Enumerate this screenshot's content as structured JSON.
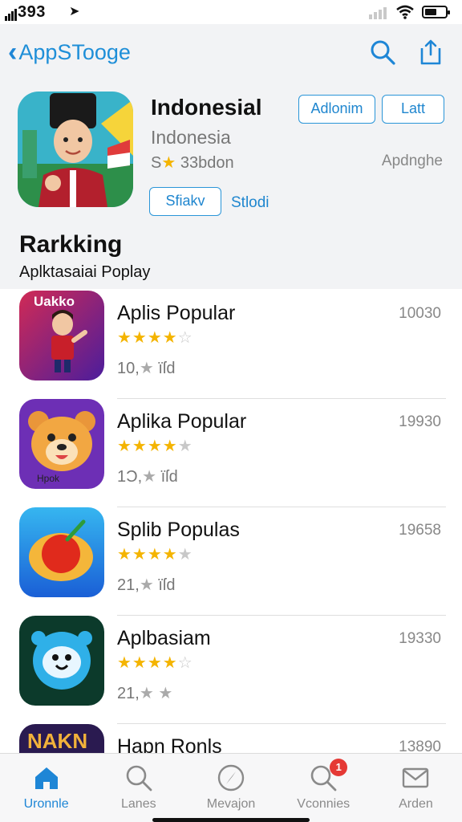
{
  "status": {
    "time": "393"
  },
  "header": {
    "back_label": "AppSTooge"
  },
  "featured": {
    "title": "Indonesial",
    "subtitle": "Indonesia",
    "rating_prefix": "S",
    "rating_star": "★",
    "rating_text": "33bdon",
    "developer": "Apdnghe",
    "button_primary": "Adlonim",
    "button_secondary": "Latt",
    "button_share": "Sfiakv",
    "link_stlodi": "Stlodi"
  },
  "section": {
    "title": "Rarkking",
    "subtitle": "Aplktasaiai Poplay"
  },
  "apps": [
    {
      "name": "Aplis Popular",
      "rank": "10030",
      "stars": 3.5,
      "review_count": "10,",
      "review_tail": "ïſd",
      "icon_text": "Uakko"
    },
    {
      "name": "Aplika Popular",
      "rank": "19930",
      "stars": 3.5,
      "review_count": "1Ɔ,",
      "review_tail": "ïſd",
      "icon_text": "Hpok"
    },
    {
      "name": "Splib Populas",
      "rank": "19658",
      "stars": 3.5,
      "review_count": "21,",
      "review_tail": "ïſd",
      "icon_text": ""
    },
    {
      "name": "Aplbasiam",
      "rank": "19330",
      "stars": 4,
      "review_count": "21,",
      "review_tail": "★",
      "icon_text": ""
    },
    {
      "name": "Hapn Ronls",
      "rank": "13890",
      "stars": 0,
      "review_count": "",
      "review_tail": "",
      "icon_text": "NAKN"
    }
  ],
  "tabs": [
    {
      "label": "Uronnle",
      "icon": "home-icon",
      "active": true
    },
    {
      "label": "Lanes",
      "icon": "search-icon",
      "active": false
    },
    {
      "label": "Mevajon",
      "icon": "compass-icon",
      "active": false
    },
    {
      "label": "Vconnies",
      "icon": "search-badge-icon",
      "active": false,
      "badge": "1"
    },
    {
      "label": "Arden",
      "icon": "mail-icon",
      "active": false
    }
  ],
  "colors": {
    "accent": "#1e86d6",
    "star": "#f4b400",
    "badge": "#e53935"
  }
}
